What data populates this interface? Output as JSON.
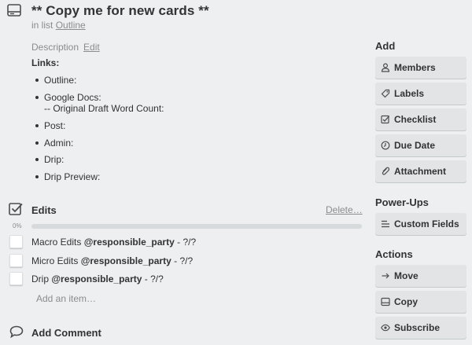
{
  "card": {
    "title": "** Copy me for new cards **",
    "in_list_prefix": "in list",
    "list_name": "Outline"
  },
  "description": {
    "label": "Description",
    "edit_label": "Edit",
    "links_heading": "Links:",
    "items": [
      {
        "label": "Outline:"
      },
      {
        "label": "Google Docs:",
        "sub": "-- Original Draft Word Count:"
      },
      {
        "label": "Post:"
      },
      {
        "label": "Admin:"
      },
      {
        "label": "Drip:"
      },
      {
        "label": "Drip Preview:"
      }
    ]
  },
  "checklist": {
    "title": "Edits",
    "delete_label": "Delete…",
    "progress_label": "0%",
    "progress_fraction": 0,
    "items": [
      {
        "prefix": "Macro Edits",
        "mention": "@responsible_party",
        "suffix": "- ?/?"
      },
      {
        "prefix": "Micro Edits",
        "mention": "@responsible_party",
        "suffix": "- ?/?"
      },
      {
        "prefix": "Drip",
        "mention": "@responsible_party",
        "suffix": "- ?/?"
      }
    ],
    "add_item_label": "Add an item…"
  },
  "comment": {
    "title": "Add Comment"
  },
  "sidebar": {
    "add_heading": "Add",
    "add_buttons": [
      {
        "label": "Members",
        "icon": "person-icon"
      },
      {
        "label": "Labels",
        "icon": "tag-icon"
      },
      {
        "label": "Checklist",
        "icon": "checkbox-icon"
      },
      {
        "label": "Due Date",
        "icon": "clock-icon"
      },
      {
        "label": "Attachment",
        "icon": "paperclip-icon"
      }
    ],
    "powerups_heading": "Power-Ups",
    "powerups_buttons": [
      {
        "label": "Custom Fields",
        "icon": "lines-icon"
      }
    ],
    "actions_heading": "Actions",
    "actions_buttons": [
      {
        "label": "Move",
        "icon": "arrow-right-icon"
      },
      {
        "label": "Copy",
        "icon": "card-icon"
      },
      {
        "label": "Subscribe",
        "icon": "eye-icon"
      }
    ]
  },
  "colors": {
    "background": "#edeff0",
    "button": "#e2e4e6",
    "progress_track": "#d6dadc",
    "progress_fill": "#5ba4cf"
  }
}
